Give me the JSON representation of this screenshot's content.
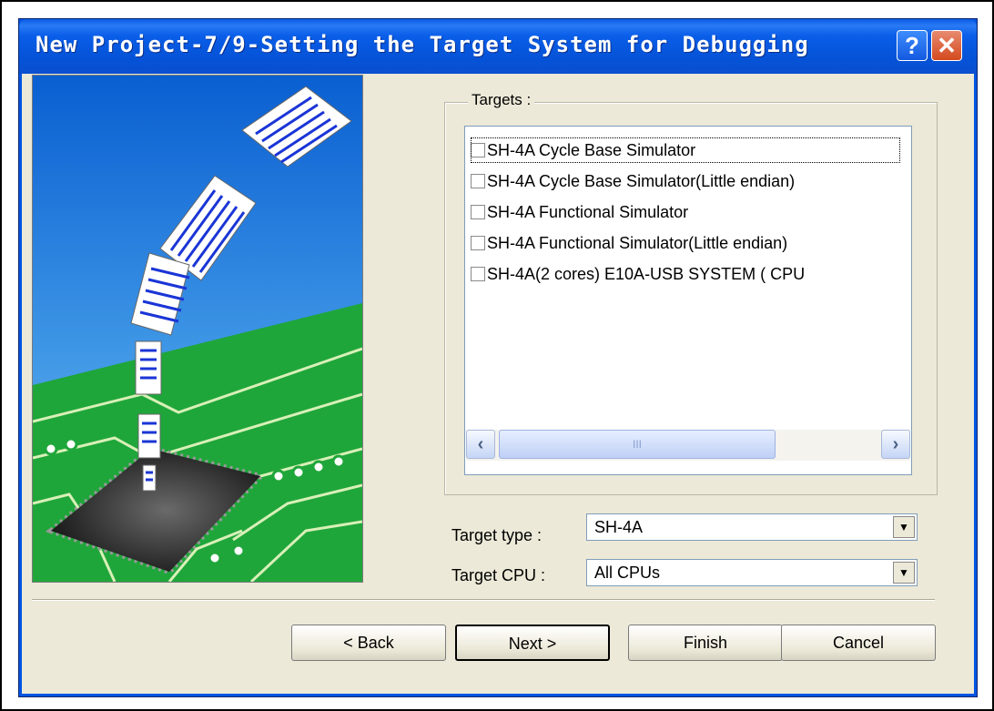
{
  "dialog": {
    "title": "New Project-7/9-Setting the Target System for Debugging",
    "help_label": "?",
    "close_label": "✕"
  },
  "targets": {
    "label": "Targets :",
    "items": [
      "SH-4A Cycle Base Simulator",
      "SH-4A Cycle Base Simulator(Little endian)",
      "SH-4A Functional Simulator",
      "SH-4A Functional Simulator(Little endian)",
      "SH-4A(2 cores) E10A-USB SYSTEM ( CPU"
    ],
    "scroll_left": "‹",
    "scroll_right": "›",
    "scroll_grip": "III"
  },
  "target_type": {
    "label": "Target type :",
    "value": "SH-4A",
    "drop": "▼"
  },
  "target_cpu": {
    "label": "Target CPU :",
    "value": "All CPUs",
    "drop": "▼"
  },
  "buttons": {
    "back": "< Back",
    "next": "Next >",
    "finish": "Finish",
    "cancel": "Cancel"
  }
}
